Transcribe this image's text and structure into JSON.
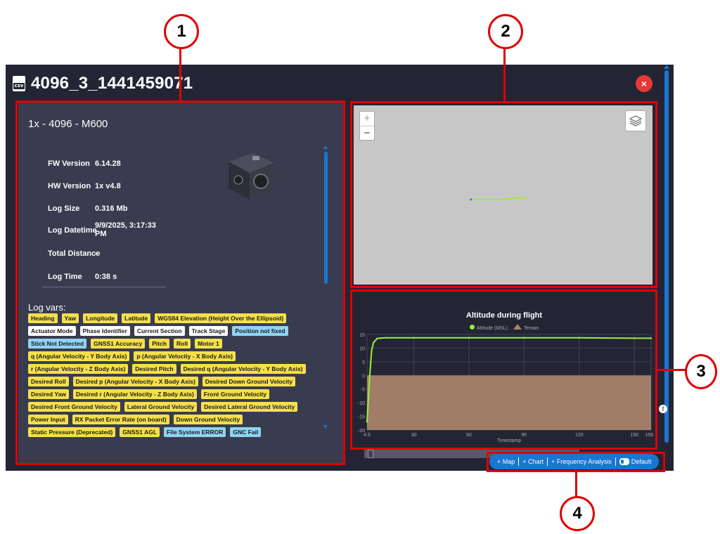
{
  "window": {
    "title": "4096_3_1441459071",
    "file_icon": "csv-file-icon",
    "file_icon_text": "csv",
    "close_icon": "close-icon",
    "close_symbol": "×",
    "chat_symbol": "!"
  },
  "device": {
    "title": "1x - 4096 - M600",
    "info": [
      {
        "label": "FW Version",
        "value": "6.14.28"
      },
      {
        "label": "HW Version",
        "value": "1x v4.8"
      },
      {
        "label": "Log Size",
        "value": "0.316 Mb"
      },
      {
        "label": "Log Datetime",
        "value": "9/9/2025, 3:17:33 PM"
      },
      {
        "label": "Total Distance",
        "value": "-"
      },
      {
        "label": "Log Time",
        "value": "0:38 s"
      }
    ]
  },
  "log_vars": {
    "title": "Log vars:",
    "tags": [
      {
        "label": "Heading",
        "color": "yellow"
      },
      {
        "label": "Yaw",
        "color": "yellow"
      },
      {
        "label": "Longitude",
        "color": "yellow"
      },
      {
        "label": "Latitude",
        "color": "yellow"
      },
      {
        "label": "WGS84 Elevation (Height Over the Ellipsoid)",
        "color": "yellow"
      },
      {
        "label": "Actuator Mode",
        "color": "white"
      },
      {
        "label": "Phase Identifier",
        "color": "white"
      },
      {
        "label": "Current Section",
        "color": "white"
      },
      {
        "label": "Track Stage",
        "color": "white"
      },
      {
        "label": "Position not fixed",
        "color": "blue"
      },
      {
        "label": "Stick Not Detected",
        "color": "blue"
      },
      {
        "label": "GNSS1 Accuracy",
        "color": "yellow"
      },
      {
        "label": "Pitch",
        "color": "yellow"
      },
      {
        "label": "Roll",
        "color": "yellow"
      },
      {
        "label": "Motor 1",
        "color": "yellow"
      },
      {
        "label": "q (Angular Velocity - Y Body Axis)",
        "color": "yellow"
      },
      {
        "label": "p (Angular Velocity - X Body Axis)",
        "color": "yellow"
      },
      {
        "label": "r (Angular Velocity - Z Body Axis)",
        "color": "yellow"
      },
      {
        "label": "Desired Pitch",
        "color": "yellow"
      },
      {
        "label": "Desired q (Angular Velocity - Y Body Axis)",
        "color": "yellow"
      },
      {
        "label": "Desired Roll",
        "color": "yellow"
      },
      {
        "label": "Desired p (Angular Velocity - X Body Axis)",
        "color": "yellow"
      },
      {
        "label": "Desired Down Ground Velocity",
        "color": "yellow"
      },
      {
        "label": "Desired Yaw",
        "color": "yellow"
      },
      {
        "label": "Desired r (Angular Velocity - Z Body Axis)",
        "color": "yellow"
      },
      {
        "label": "Front Ground Velocity",
        "color": "yellow"
      },
      {
        "label": "Desired Front Ground Velocity",
        "color": "yellow"
      },
      {
        "label": "Lateral Ground Velocity",
        "color": "yellow"
      },
      {
        "label": "Desired Lateral Ground Velocity",
        "color": "yellow"
      },
      {
        "label": "Power Input",
        "color": "yellow"
      },
      {
        "label": "RX Packet Error Rate (on board)",
        "color": "yellow"
      },
      {
        "label": "Down Ground Velocity",
        "color": "yellow"
      },
      {
        "label": "Static Pressure (Deprecated)",
        "color": "yellow"
      },
      {
        "label": "GNSS1 AGL",
        "color": "yellow"
      },
      {
        "label": "File System ERROR",
        "color": "blue"
      },
      {
        "label": "GNC Fail",
        "color": "blue"
      }
    ]
  },
  "map": {
    "zoom_in": "+",
    "zoom_out": "−",
    "zoom_in_icon": "zoom-in-icon",
    "zoom_out_icon": "zoom-out-icon",
    "layers_icon": "layers-icon",
    "track_color": "#9bef3a"
  },
  "chart_data": {
    "type": "line",
    "title": "Altitude during flight",
    "xlabel": "Timestamp",
    "ylabel": "",
    "xlim": [
      4.5,
      159.1
    ],
    "ylim": [
      -20,
      15
    ],
    "x_ticks": [
      4.5,
      30,
      60,
      90,
      120,
      150,
      159.1
    ],
    "x_tick_labels": [
      "4.5",
      "30",
      "60",
      "90",
      "120",
      "150",
      "159.1"
    ],
    "y_ticks": [
      15,
      10,
      5,
      0,
      -5,
      -10,
      -15,
      -20
    ],
    "grid": true,
    "legend_placement": "top-center",
    "series": [
      {
        "name": "Altitude (MSL)",
        "color": "#9bef3a",
        "x": [
          4.5,
          6,
          7,
          8,
          10,
          12,
          15,
          30,
          60,
          90,
          120,
          150,
          159.1
        ],
        "values": [
          -17,
          0,
          9,
          12,
          13.5,
          13.7,
          13.8,
          13.8,
          13.8,
          13.8,
          13.8,
          13.6,
          13.6
        ]
      },
      {
        "name": "Terrain",
        "color": "#a9826c",
        "x": [
          4.5,
          159.1
        ],
        "values": [
          0,
          0
        ]
      }
    ]
  },
  "toolbar": {
    "items": [
      {
        "label": "+ Map"
      },
      {
        "label": "+ Chart"
      },
      {
        "label": "+ Frequency Analysis"
      },
      {
        "label": "Default"
      }
    ]
  },
  "annotations": {
    "badges": [
      "1",
      "2",
      "3",
      "4"
    ],
    "color": "#e00000"
  },
  "colors": {
    "window_bg": "#232535",
    "panel_bg": "#393c4f",
    "accent": "#1976d2",
    "close": "#e53935"
  }
}
